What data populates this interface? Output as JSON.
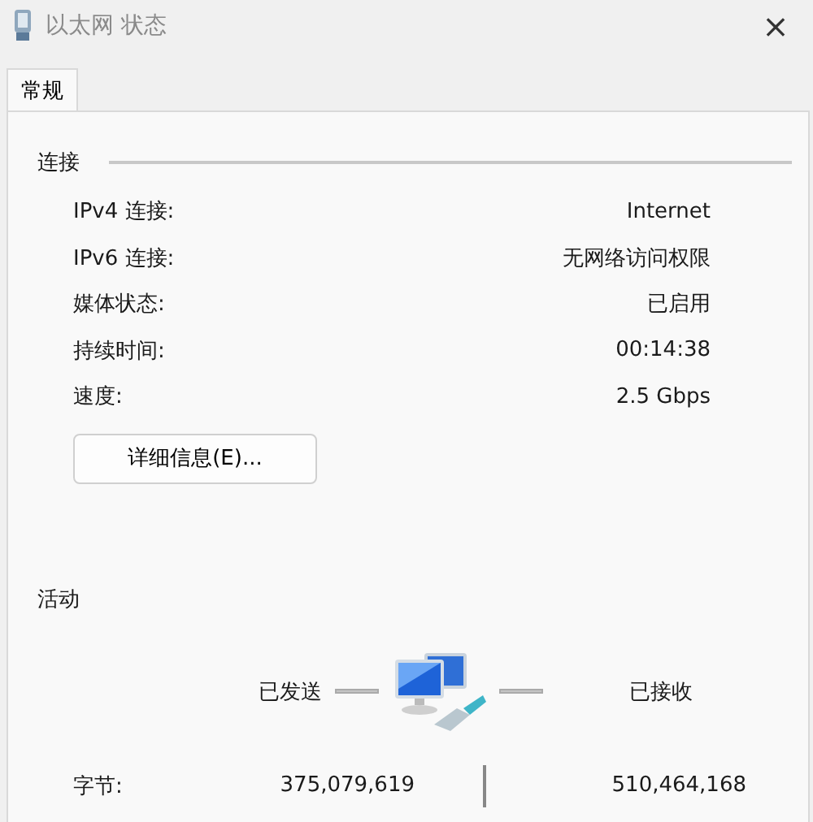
{
  "window": {
    "title": "以太网 状态",
    "close": "×"
  },
  "tabs": [
    {
      "label": "常规",
      "selected": true
    }
  ],
  "connection": {
    "heading": "连接",
    "rows": [
      {
        "label": "IPv4 连接:",
        "value": "Internet"
      },
      {
        "label": "IPv6 连接:",
        "value": "无网络访问权限"
      },
      {
        "label": "媒体状态:",
        "value": "已启用"
      },
      {
        "label": "持续时间:",
        "value": "00:14:38"
      },
      {
        "label": "速度:",
        "value": "2.5 Gbps"
      }
    ],
    "details_button": "详细信息(E)..."
  },
  "activity": {
    "heading": "活动",
    "sent_label": "已发送",
    "received_label": "已接收",
    "bytes_label": "字节:",
    "bytes_sent": "375,079,619",
    "bytes_received": "510,464,168"
  }
}
